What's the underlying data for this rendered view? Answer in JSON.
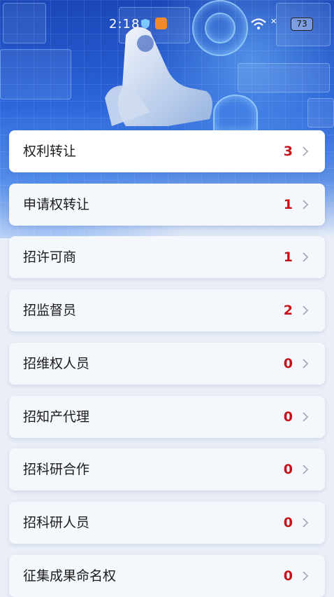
{
  "status_bar": {
    "time": "2:18",
    "battery": "73",
    "network_icon": "wifi-icon"
  },
  "list": {
    "items": [
      {
        "label": "权利转让",
        "count": "3"
      },
      {
        "label": "申请权转让",
        "count": "1"
      },
      {
        "label": "招许可商",
        "count": "1"
      },
      {
        "label": "招监督员",
        "count": "2"
      },
      {
        "label": "招维权人员",
        "count": "0"
      },
      {
        "label": "招知产代理",
        "count": "0"
      },
      {
        "label": "招科研合作",
        "count": "0"
      },
      {
        "label": "招科研人员",
        "count": "0"
      },
      {
        "label": "征集成果命名权",
        "count": "0"
      }
    ]
  },
  "colors": {
    "count": "#c8121a",
    "hero_top": "#1a46b8",
    "background": "#e9eef7"
  }
}
